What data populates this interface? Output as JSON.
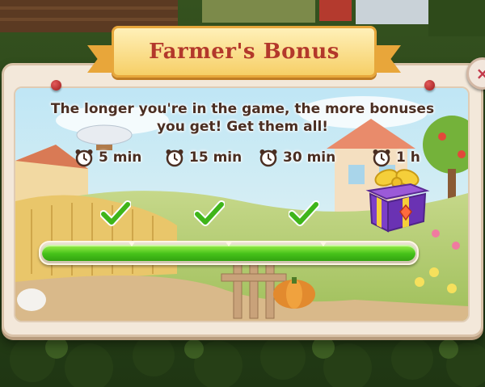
{
  "dialog": {
    "title": "Farmer's Bonus",
    "message": "The longer you're in the game, the more bonuses you get! Get them all!",
    "close_label": "×"
  },
  "milestones": [
    {
      "label": "5 min",
      "icon": "alarm-clock-icon",
      "claimed": true
    },
    {
      "label": "15 min",
      "icon": "alarm-clock-icon",
      "claimed": true
    },
    {
      "label": "30 min",
      "icon": "alarm-clock-icon",
      "claimed": true
    },
    {
      "label": "1 h",
      "icon": "alarm-clock-icon",
      "claimed": false
    }
  ],
  "reward": {
    "icon": "purple-gift-box-icon"
  },
  "progress": {
    "fraction": 1.0
  },
  "colors": {
    "title": "#b3382b",
    "ribbon": "#f6cf67",
    "progress_green": "#46c21a",
    "text": "#4a2e22",
    "gift": "#7b3fc8"
  }
}
